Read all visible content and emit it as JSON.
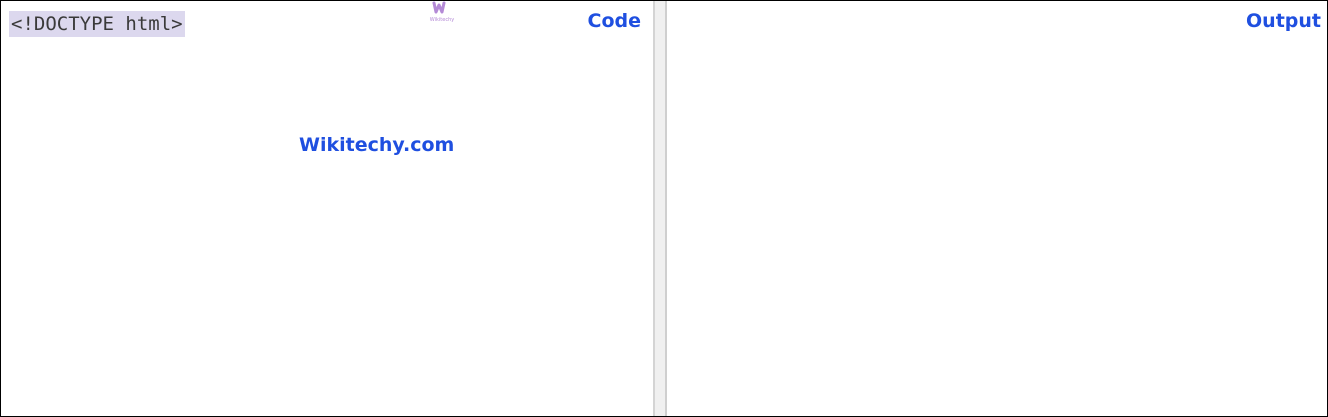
{
  "code_pane": {
    "label": "Code",
    "code_line": "<!DOCTYPE html>"
  },
  "output_pane": {
    "label": "Output"
  },
  "watermark": {
    "text": "Wikitechy.com",
    "logo_text": "Wikitechy"
  },
  "colors": {
    "accent": "#1f4fe0",
    "code_highlight": "#dcd8ee",
    "logo": "#b48ad6"
  }
}
